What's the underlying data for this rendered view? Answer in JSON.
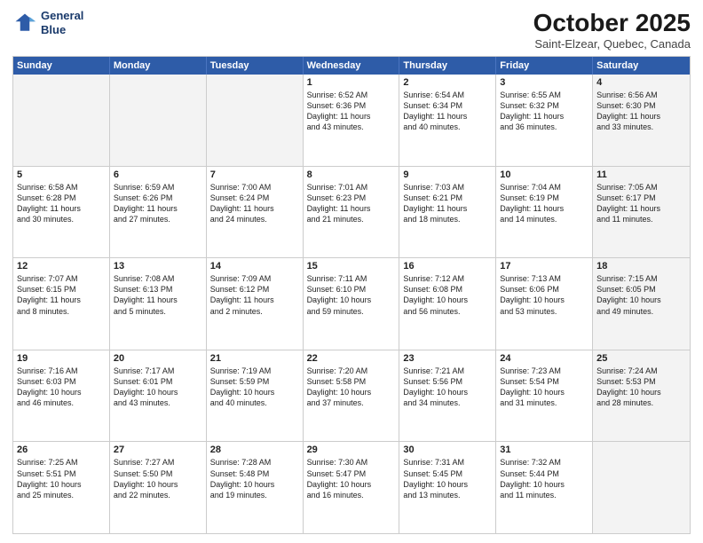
{
  "header": {
    "logo_line1": "General",
    "logo_line2": "Blue",
    "month": "October 2025",
    "location": "Saint-Elzear, Quebec, Canada"
  },
  "weekdays": [
    "Sunday",
    "Monday",
    "Tuesday",
    "Wednesday",
    "Thursday",
    "Friday",
    "Saturday"
  ],
  "weeks": [
    [
      {
        "day": "",
        "text": "",
        "shaded": true
      },
      {
        "day": "",
        "text": "",
        "shaded": true
      },
      {
        "day": "",
        "text": "",
        "shaded": true
      },
      {
        "day": "1",
        "text": "Sunrise: 6:52 AM\nSunset: 6:36 PM\nDaylight: 11 hours\nand 43 minutes."
      },
      {
        "day": "2",
        "text": "Sunrise: 6:54 AM\nSunset: 6:34 PM\nDaylight: 11 hours\nand 40 minutes."
      },
      {
        "day": "3",
        "text": "Sunrise: 6:55 AM\nSunset: 6:32 PM\nDaylight: 11 hours\nand 36 minutes."
      },
      {
        "day": "4",
        "text": "Sunrise: 6:56 AM\nSunset: 6:30 PM\nDaylight: 11 hours\nand 33 minutes.",
        "shaded": true
      }
    ],
    [
      {
        "day": "5",
        "text": "Sunrise: 6:58 AM\nSunset: 6:28 PM\nDaylight: 11 hours\nand 30 minutes."
      },
      {
        "day": "6",
        "text": "Sunrise: 6:59 AM\nSunset: 6:26 PM\nDaylight: 11 hours\nand 27 minutes."
      },
      {
        "day": "7",
        "text": "Sunrise: 7:00 AM\nSunset: 6:24 PM\nDaylight: 11 hours\nand 24 minutes."
      },
      {
        "day": "8",
        "text": "Sunrise: 7:01 AM\nSunset: 6:23 PM\nDaylight: 11 hours\nand 21 minutes."
      },
      {
        "day": "9",
        "text": "Sunrise: 7:03 AM\nSunset: 6:21 PM\nDaylight: 11 hours\nand 18 minutes."
      },
      {
        "day": "10",
        "text": "Sunrise: 7:04 AM\nSunset: 6:19 PM\nDaylight: 11 hours\nand 14 minutes."
      },
      {
        "day": "11",
        "text": "Sunrise: 7:05 AM\nSunset: 6:17 PM\nDaylight: 11 hours\nand 11 minutes.",
        "shaded": true
      }
    ],
    [
      {
        "day": "12",
        "text": "Sunrise: 7:07 AM\nSunset: 6:15 PM\nDaylight: 11 hours\nand 8 minutes."
      },
      {
        "day": "13",
        "text": "Sunrise: 7:08 AM\nSunset: 6:13 PM\nDaylight: 11 hours\nand 5 minutes."
      },
      {
        "day": "14",
        "text": "Sunrise: 7:09 AM\nSunset: 6:12 PM\nDaylight: 11 hours\nand 2 minutes."
      },
      {
        "day": "15",
        "text": "Sunrise: 7:11 AM\nSunset: 6:10 PM\nDaylight: 10 hours\nand 59 minutes."
      },
      {
        "day": "16",
        "text": "Sunrise: 7:12 AM\nSunset: 6:08 PM\nDaylight: 10 hours\nand 56 minutes."
      },
      {
        "day": "17",
        "text": "Sunrise: 7:13 AM\nSunset: 6:06 PM\nDaylight: 10 hours\nand 53 minutes."
      },
      {
        "day": "18",
        "text": "Sunrise: 7:15 AM\nSunset: 6:05 PM\nDaylight: 10 hours\nand 49 minutes.",
        "shaded": true
      }
    ],
    [
      {
        "day": "19",
        "text": "Sunrise: 7:16 AM\nSunset: 6:03 PM\nDaylight: 10 hours\nand 46 minutes."
      },
      {
        "day": "20",
        "text": "Sunrise: 7:17 AM\nSunset: 6:01 PM\nDaylight: 10 hours\nand 43 minutes."
      },
      {
        "day": "21",
        "text": "Sunrise: 7:19 AM\nSunset: 5:59 PM\nDaylight: 10 hours\nand 40 minutes."
      },
      {
        "day": "22",
        "text": "Sunrise: 7:20 AM\nSunset: 5:58 PM\nDaylight: 10 hours\nand 37 minutes."
      },
      {
        "day": "23",
        "text": "Sunrise: 7:21 AM\nSunset: 5:56 PM\nDaylight: 10 hours\nand 34 minutes."
      },
      {
        "day": "24",
        "text": "Sunrise: 7:23 AM\nSunset: 5:54 PM\nDaylight: 10 hours\nand 31 minutes."
      },
      {
        "day": "25",
        "text": "Sunrise: 7:24 AM\nSunset: 5:53 PM\nDaylight: 10 hours\nand 28 minutes.",
        "shaded": true
      }
    ],
    [
      {
        "day": "26",
        "text": "Sunrise: 7:25 AM\nSunset: 5:51 PM\nDaylight: 10 hours\nand 25 minutes."
      },
      {
        "day": "27",
        "text": "Sunrise: 7:27 AM\nSunset: 5:50 PM\nDaylight: 10 hours\nand 22 minutes."
      },
      {
        "day": "28",
        "text": "Sunrise: 7:28 AM\nSunset: 5:48 PM\nDaylight: 10 hours\nand 19 minutes."
      },
      {
        "day": "29",
        "text": "Sunrise: 7:30 AM\nSunset: 5:47 PM\nDaylight: 10 hours\nand 16 minutes."
      },
      {
        "day": "30",
        "text": "Sunrise: 7:31 AM\nSunset: 5:45 PM\nDaylight: 10 hours\nand 13 minutes."
      },
      {
        "day": "31",
        "text": "Sunrise: 7:32 AM\nSunset: 5:44 PM\nDaylight: 10 hours\nand 11 minutes."
      },
      {
        "day": "",
        "text": "",
        "shaded": true
      }
    ]
  ]
}
